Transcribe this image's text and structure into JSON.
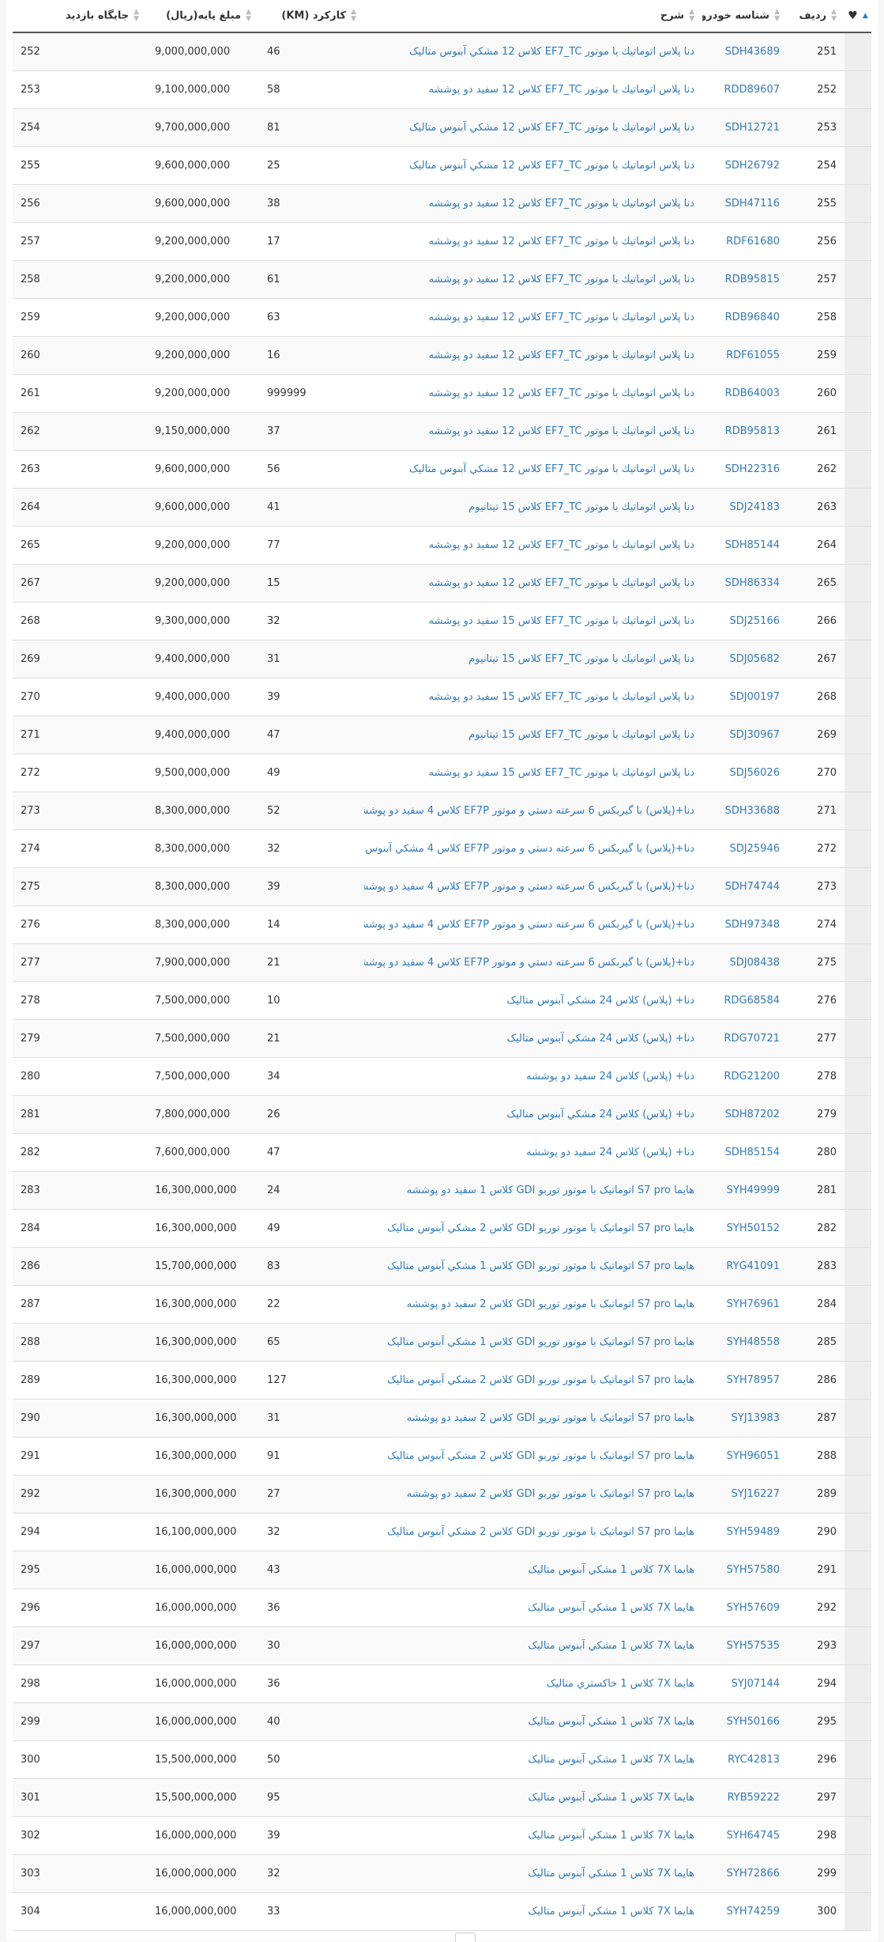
{
  "table": {
    "headers": {
      "favorite_icon": "heart-icon",
      "row_number": "ردیف",
      "car_id": "شناسه خودرو",
      "description": "شرح",
      "mileage": "کارکرد (KM)",
      "base_price": "مبلغ پایه(ریال)",
      "visit_slot": "جایگاه بازدید"
    },
    "rows": [
      [
        "251",
        "SDH43689",
        "دنا پلاس اتوماتيك با موتور EF7_TC كلاس 12 مشكي آبنوس متاليک",
        "46",
        "9,000,000,000",
        "252"
      ],
      [
        "252",
        "RDD89607",
        "دنا پلاس اتوماتيك با موتور EF7_TC كلاس 12 سفيد دو پوششه",
        "58",
        "9,100,000,000",
        "253"
      ],
      [
        "253",
        "SDH12721",
        "دنا پلاس اتوماتيك با موتور EF7_TC كلاس 12 مشكي آبنوس متاليک",
        "81",
        "9,700,000,000",
        "254"
      ],
      [
        "254",
        "SDH26792",
        "دنا پلاس اتوماتيك با موتور EF7_TC كلاس 12 مشكي آبنوس متاليک",
        "25",
        "9,600,000,000",
        "255"
      ],
      [
        "255",
        "SDH47116",
        "دنا پلاس اتوماتيك با موتور EF7_TC كلاس 12 سفيد دو پوششه",
        "38",
        "9,600,000,000",
        "256"
      ],
      [
        "256",
        "RDF61680",
        "دنا پلاس اتوماتيك با موتور EF7_TC كلاس 12 سفيد دو پوششه",
        "17",
        "9,200,000,000",
        "257"
      ],
      [
        "257",
        "RDB95815",
        "دنا پلاس اتوماتيك با موتور EF7_TC كلاس 12 سفيد دو پوششه",
        "61",
        "9,200,000,000",
        "258"
      ],
      [
        "258",
        "RDB96840",
        "دنا پلاس اتوماتيك با موتور EF7_TC كلاس 12 سفيد دو پوششه",
        "63",
        "9,200,000,000",
        "259"
      ],
      [
        "259",
        "RDF61055",
        "دنا پلاس اتوماتيك با موتور EF7_TC كلاس 12 سفيد دو پوششه",
        "16",
        "9,200,000,000",
        "260"
      ],
      [
        "260",
        "RDB64003",
        "دنا پلاس اتوماتيك با موتور EF7_TC كلاس 12 سفيد دو پوششه",
        "999999",
        "9,200,000,000",
        "261"
      ],
      [
        "261",
        "RDB95813",
        "دنا پلاس اتوماتيك با موتور EF7_TC كلاس 12 سفيد دو پوششه",
        "37",
        "9,150,000,000",
        "262"
      ],
      [
        "262",
        "SDH22316",
        "دنا پلاس اتوماتيك با موتور EF7_TC كلاس 12 مشكي آبنوس متاليک",
        "56",
        "9,600,000,000",
        "263"
      ],
      [
        "263",
        "SDJ24183",
        "دنا پلاس اتوماتيك با موتور EF7_TC كلاس 15 تيتانيوم",
        "41",
        "9,600,000,000",
        "264"
      ],
      [
        "264",
        "SDH85144",
        "دنا پلاس اتوماتيك با موتور EF7_TC كلاس 12 سفيد دو پوششه",
        "77",
        "9,200,000,000",
        "265"
      ],
      [
        "265",
        "SDH86334",
        "دنا پلاس اتوماتيك با موتور EF7_TC كلاس 12 سفيد دو پوششه",
        "15",
        "9,200,000,000",
        "267"
      ],
      [
        "266",
        "SDJ25166",
        "دنا پلاس اتوماتيك با موتور EF7_TC كلاس 15 سفيد دو پوششه",
        "32",
        "9,300,000,000",
        "268"
      ],
      [
        "267",
        "SDJ05682",
        "دنا پلاس اتوماتيك با موتور EF7_TC كلاس 15 تيتانيوم",
        "31",
        "9,400,000,000",
        "269"
      ],
      [
        "268",
        "SDJ00197",
        "دنا پلاس اتوماتيك با موتور EF7_TC كلاس 15 سفيد دو پوششه",
        "39",
        "9,400,000,000",
        "270"
      ],
      [
        "269",
        "SDJ30967",
        "دنا پلاس اتوماتيك با موتور EF7_TC كلاس 15 تيتانيوم",
        "47",
        "9,400,000,000",
        "271"
      ],
      [
        "270",
        "SDJ56026",
        "دنا پلاس اتوماتيك با موتور EF7_TC كلاس 15 سفيد دو پوششه",
        "49",
        "9,500,000,000",
        "272"
      ],
      [
        "271",
        "SDH33688",
        "دنا+(پلاس) با گيربكس 6 سرعته دستي و موتور EF7P كلاس 4 سفيد دو پوششه",
        "52",
        "8,300,000,000",
        "273"
      ],
      [
        "272",
        "SDJ25946",
        "دنا+(پلاس) با گيربكس 6 سرعته دستي و موتور EF7P كلاس 4 مشكي آبنوس متاليک",
        "32",
        "8,300,000,000",
        "274"
      ],
      [
        "273",
        "SDH74744",
        "دنا+(پلاس) با گيربكس 6 سرعته دستي و موتور EF7P كلاس 4 سفيد دو پوششه",
        "39",
        "8,300,000,000",
        "275"
      ],
      [
        "274",
        "SDH97348",
        "دنا+(پلاس) با گيربكس 6 سرعته دستي و موتور EF7P كلاس 4 سفيد دو پوششه",
        "14",
        "8,300,000,000",
        "276"
      ],
      [
        "275",
        "SDJ08438",
        "دنا+(پلاس) با گيربكس 6 سرعته دستي و موتور EF7P كلاس 4 سفيد دو پوششه",
        "21",
        "7,900,000,000",
        "277"
      ],
      [
        "276",
        "RDG68584",
        "دنا+ (پلاس) كلاس 24 مشكي آبنوس متاليک",
        "10",
        "7,500,000,000",
        "278"
      ],
      [
        "277",
        "RDG70721",
        "دنا+ (پلاس) كلاس 24 مشكي آبنوس متاليک",
        "21",
        "7,500,000,000",
        "279"
      ],
      [
        "278",
        "RDG21200",
        "دنا+ (پلاس) كلاس 24 سفيد دو پوششه",
        "34",
        "7,500,000,000",
        "280"
      ],
      [
        "279",
        "SDH87202",
        "دنا+ (پلاس) كلاس 24 مشكي آبنوس متاليک",
        "26",
        "7,800,000,000",
        "281"
      ],
      [
        "280",
        "SDH85154",
        "دنا+ (پلاس) كلاس 24 سفيد دو پوششه",
        "47",
        "7,600,000,000",
        "282"
      ],
      [
        "281",
        "SYH49999",
        "هايما S7 pro اتوماتيک با موتور توربو GDI كلاس 1 سفيد دو پوششه",
        "24",
        "16,300,000,000",
        "283"
      ],
      [
        "282",
        "SYH50152",
        "هايما S7 pro اتوماتيک با موتور توربو GDI كلاس 2 مشكي آبنوس متاليک",
        "49",
        "16,300,000,000",
        "284"
      ],
      [
        "283",
        "RYG41091",
        "هايما S7 pro اتوماتيک با موتور توربو GDI كلاس 1 مشكي آبنوس متاليک",
        "83",
        "15,700,000,000",
        "286"
      ],
      [
        "284",
        "SYH76961",
        "هايما S7 pro اتوماتيک با موتور توربو GDI كلاس 2 سفيد دو پوششه",
        "22",
        "16,300,000,000",
        "287"
      ],
      [
        "285",
        "SYH48558",
        "هايما S7 pro اتوماتيک با موتور توربو GDI كلاس 1 مشكي آبنوس متاليک",
        "65",
        "16,300,000,000",
        "288"
      ],
      [
        "286",
        "SYH78957",
        "هايما S7 pro اتوماتيک با موتور توربو GDI كلاس 2 مشكي آبنوس متاليک",
        "127",
        "16,300,000,000",
        "289"
      ],
      [
        "287",
        "SYJ13983",
        "هايما S7 pro اتوماتيک با موتور توربو GDI كلاس 2 سفيد دو پوششه",
        "31",
        "16,300,000,000",
        "290"
      ],
      [
        "288",
        "SYH96051",
        "هايما S7 pro اتوماتيک با موتور توربو GDI كلاس 2 مشكي آبنوس متاليک",
        "91",
        "16,300,000,000",
        "291"
      ],
      [
        "289",
        "SYJ16227",
        "هايما S7 pro اتوماتيک با موتور توربو GDI كلاس 2 سفيد دو پوششه",
        "27",
        "16,300,000,000",
        "292"
      ],
      [
        "290",
        "SYH59489",
        "هايما S7 pro اتوماتيک با موتور توربو GDI كلاس 2 مشكي آبنوس متاليک",
        "32",
        "16,100,000,000",
        "294"
      ],
      [
        "291",
        "SYH57580",
        "هايما 7X كلاس 1 مشكي آبنوس متاليک",
        "43",
        "16,000,000,000",
        "295"
      ],
      [
        "292",
        "SYH57609",
        "هايما 7X كلاس 1 مشكي آبنوس متاليک",
        "36",
        "16,000,000,000",
        "296"
      ],
      [
        "293",
        "SYH57535",
        "هايما 7X كلاس 1 مشكي آبنوس متاليک",
        "30",
        "16,000,000,000",
        "297"
      ],
      [
        "294",
        "SYJ07144",
        "هايما 7X كلاس 1 خاكستري متاليک",
        "36",
        "16,000,000,000",
        "298"
      ],
      [
        "295",
        "SYH50166",
        "هايما 7X كلاس 1 مشكي آبنوس متاليک",
        "40",
        "16,000,000,000",
        "299"
      ],
      [
        "296",
        "RYC42813",
        "هايما 7X كلاس 1 مشكي آبنوس متاليک",
        "50",
        "15,500,000,000",
        "300"
      ],
      [
        "297",
        "RYB59222",
        "هايما 7X كلاس 1 مشكي آبنوس متاليک",
        "95",
        "15,500,000,000",
        "301"
      ],
      [
        "298",
        "SYH64745",
        "هايما 7X كلاس 1 مشكي آبنوس متاليک",
        "39",
        "16,000,000,000",
        "302"
      ],
      [
        "299",
        "SYH72866",
        "هايما 7X كلاس 1 مشكي آبنوس متاليک",
        "32",
        "16,000,000,000",
        "303"
      ],
      [
        "300",
        "SYH74259",
        "هايما 7X كلاس 1 مشكي آبنوس متاليک",
        "33",
        "16,000,000,000",
        "304"
      ]
    ]
  },
  "colors": {
    "link": "#337ab7",
    "text": "#333333",
    "row_stripe": "#f9f9f9",
    "fav_column_bg": "#eeeeee"
  }
}
